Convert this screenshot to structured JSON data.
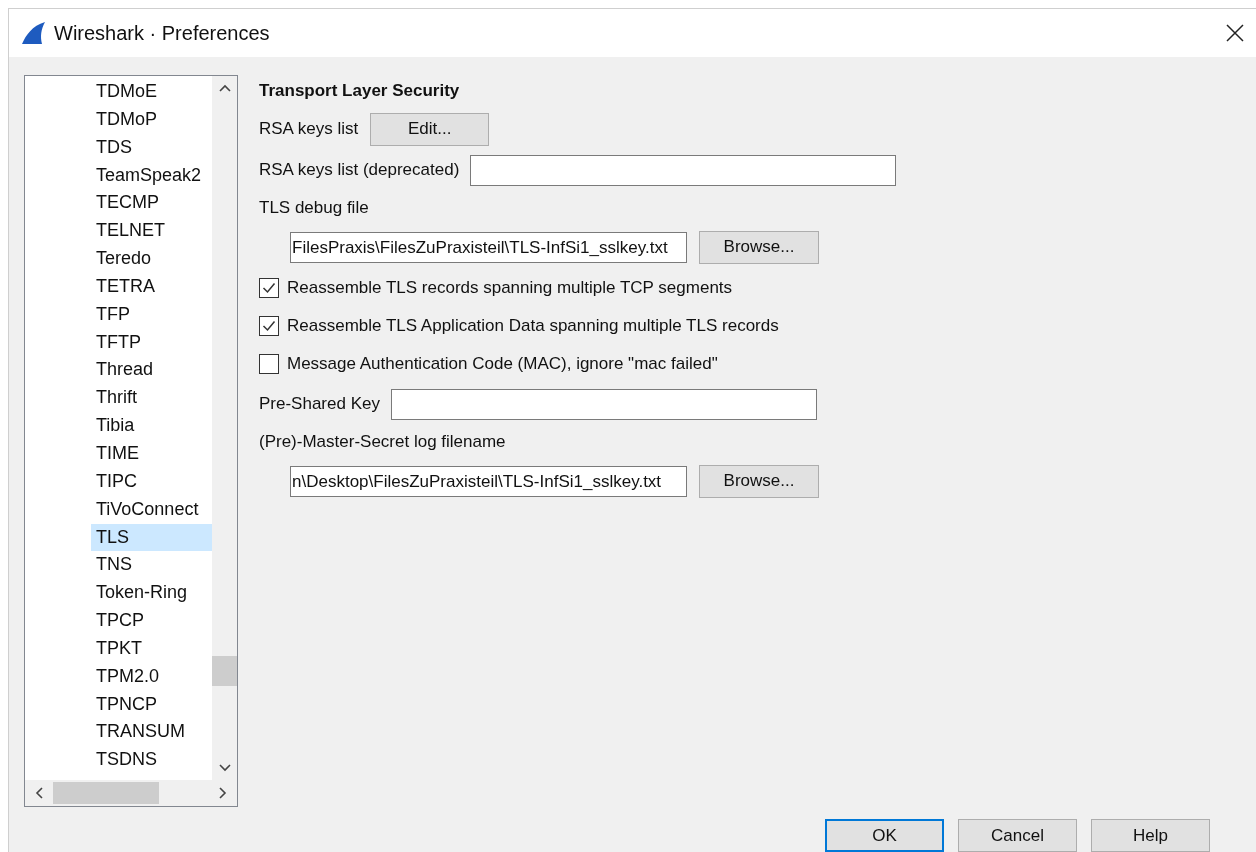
{
  "window": {
    "title": "Wireshark · Preferences"
  },
  "protocols": [
    {
      "label": "TDMoE",
      "selected": false
    },
    {
      "label": "TDMoP",
      "selected": false
    },
    {
      "label": "TDS",
      "selected": false
    },
    {
      "label": "TeamSpeak2",
      "selected": false
    },
    {
      "label": "TECMP",
      "selected": false
    },
    {
      "label": "TELNET",
      "selected": false
    },
    {
      "label": "Teredo",
      "selected": false
    },
    {
      "label": "TETRA",
      "selected": false
    },
    {
      "label": "TFP",
      "selected": false
    },
    {
      "label": "TFTP",
      "selected": false
    },
    {
      "label": "Thread",
      "selected": false
    },
    {
      "label": "Thrift",
      "selected": false
    },
    {
      "label": "Tibia",
      "selected": false
    },
    {
      "label": "TIME",
      "selected": false
    },
    {
      "label": "TIPC",
      "selected": false
    },
    {
      "label": "TiVoConnect",
      "selected": false
    },
    {
      "label": "TLS",
      "selected": true
    },
    {
      "label": "TNS",
      "selected": false
    },
    {
      "label": "Token-Ring",
      "selected": false
    },
    {
      "label": "TPCP",
      "selected": false
    },
    {
      "label": "TPKT",
      "selected": false
    },
    {
      "label": "TPM2.0",
      "selected": false
    },
    {
      "label": "TPNCP",
      "selected": false
    },
    {
      "label": "TRANSUM",
      "selected": false
    },
    {
      "label": "TSDNS",
      "selected": false
    }
  ],
  "section_title": "Transport Layer Security",
  "settings": [
    {
      "kind": "button",
      "label": "RSA keys list",
      "button": "Edit..."
    },
    {
      "kind": "text",
      "label": "RSA keys list (deprecated)"
    },
    {
      "kind": "file",
      "label": "TLS debug file",
      "value": "FilesPraxis\\FilesZuPraxisteil\\TLS-InfSi1_sslkey.txt",
      "button": "Browse..."
    },
    {
      "kind": "checkbox",
      "label": "Reassemble TLS records spanning multiple TCP segments",
      "checked": true
    },
    {
      "kind": "checkbox",
      "label": "Reassemble TLS Application Data spanning multiple TLS records",
      "checked": true
    },
    {
      "kind": "checkbox",
      "label": "Message Authentication Code (MAC), ignore \"mac failed\"",
      "checked": false
    },
    {
      "kind": "text",
      "label": "Pre-Shared Key"
    },
    {
      "kind": "file",
      "label": "(Pre)-Master-Secret log filename",
      "value": "n\\Desktop\\FilesZuPraxisteil\\TLS-InfSi1_sslkey.txt",
      "button": "Browse..."
    }
  ],
  "buttons": [
    {
      "label": "OK",
      "default": true
    },
    {
      "label": "Cancel",
      "default": false
    },
    {
      "label": "Help",
      "default": false
    }
  ]
}
